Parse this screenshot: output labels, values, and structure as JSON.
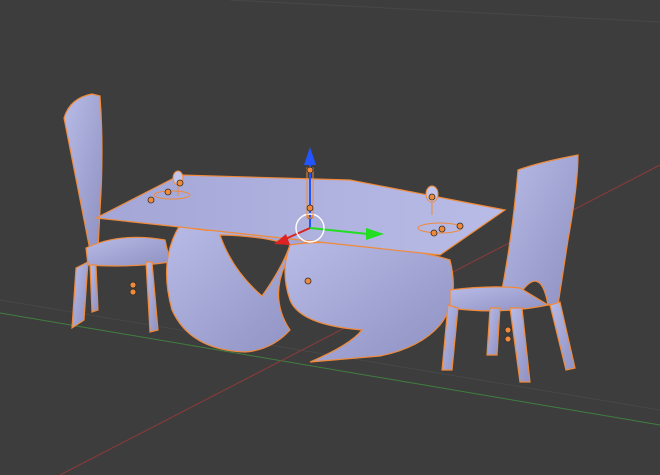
{
  "viewport": {
    "background": "#3d3d3d",
    "grid_color": "#4a4a4a",
    "x_axis_color": "#8e3a3a",
    "y_axis_color": "#3f7f3f",
    "selection_outline_color": "#f08a3a",
    "mesh_color": "#a6a9d8"
  },
  "gizmo": {
    "mode": "translate",
    "z_arrow_color": "#2255ff",
    "y_arrow_color": "#22dd22",
    "x_arrow_color": "#dd2222",
    "pivot_icon": "object-origin-icon"
  },
  "scene_objects": [
    {
      "name": "table-top",
      "selected": true
    },
    {
      "name": "table-base",
      "selected": true
    },
    {
      "name": "chair-left",
      "selected": true
    },
    {
      "name": "chair-right",
      "selected": true
    },
    {
      "name": "wine-glass-left",
      "selected": true
    },
    {
      "name": "wine-glass-right",
      "selected": true
    }
  ]
}
